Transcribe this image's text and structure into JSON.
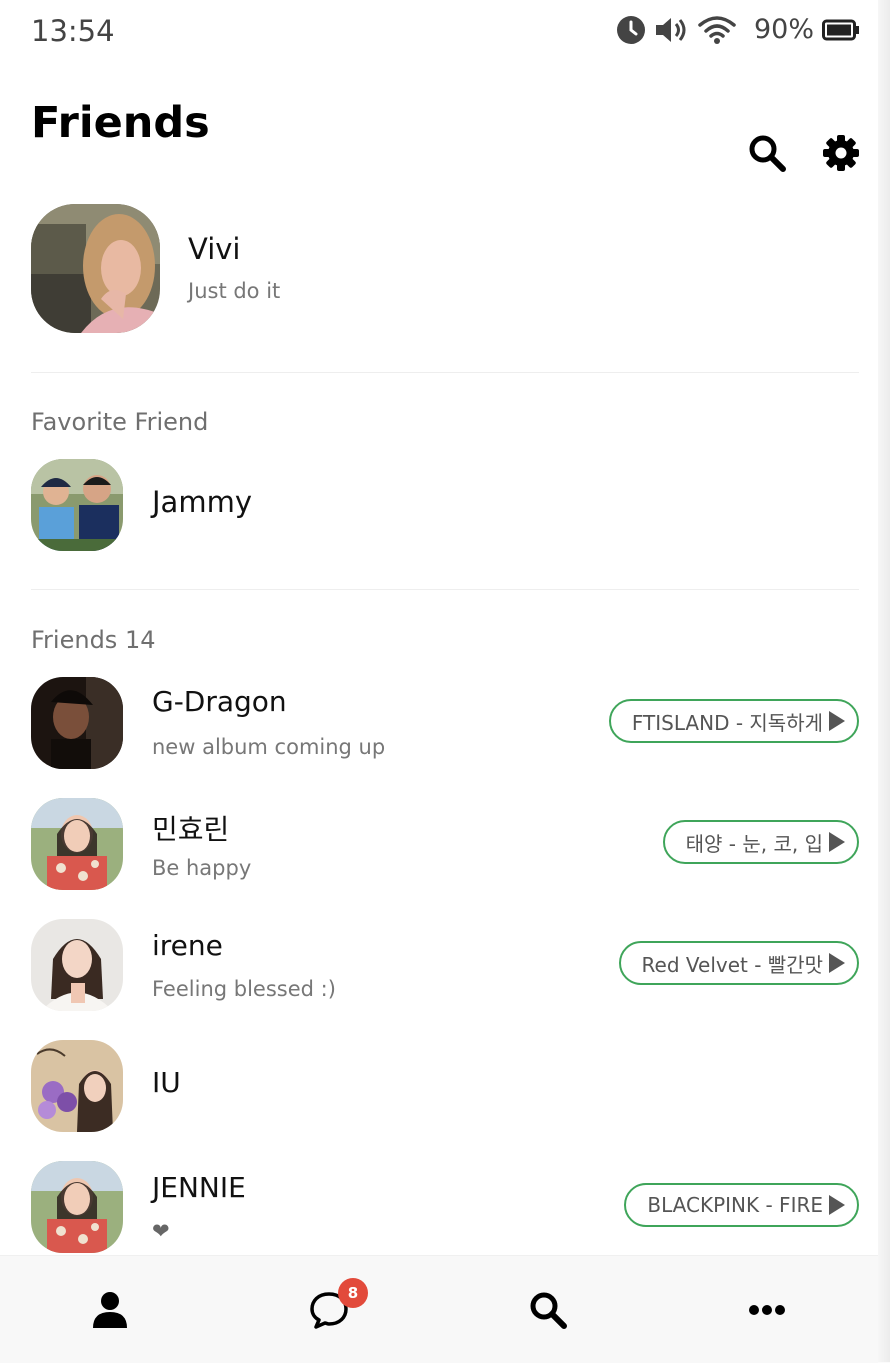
{
  "status_bar": {
    "time": "13:54",
    "battery": "90%"
  },
  "header": {
    "title": "Friends"
  },
  "profile": {
    "name": "Vivi",
    "status": "Just do it"
  },
  "favorites": {
    "label": "Favorite Friend",
    "items": [
      {
        "name": "Jammy"
      }
    ]
  },
  "friends": {
    "label": "Friends 14",
    "items": [
      {
        "name": "G-Dragon",
        "status": "new album coming up",
        "music": "FTISLAND - 지독하게"
      },
      {
        "name": "민효린",
        "status": "Be happy",
        "music": "태양 - 눈, 코, 입"
      },
      {
        "name": "irene",
        "status": "Feeling blessed :)",
        "music": "Red Velvet - 빨간맛"
      },
      {
        "name": "IU",
        "status": "",
        "music": ""
      },
      {
        "name": "JENNIE",
        "status": "❤",
        "music": "BLACKPINK - FIRE"
      }
    ]
  },
  "tabbar": {
    "items": [
      {
        "icon": "person-icon"
      },
      {
        "icon": "chat-icon",
        "badge": "8"
      },
      {
        "icon": "search-icon"
      },
      {
        "icon": "more-icon"
      }
    ]
  },
  "colors": {
    "accent_green": "#3fa55a",
    "badge_red": "#e24a3b"
  }
}
